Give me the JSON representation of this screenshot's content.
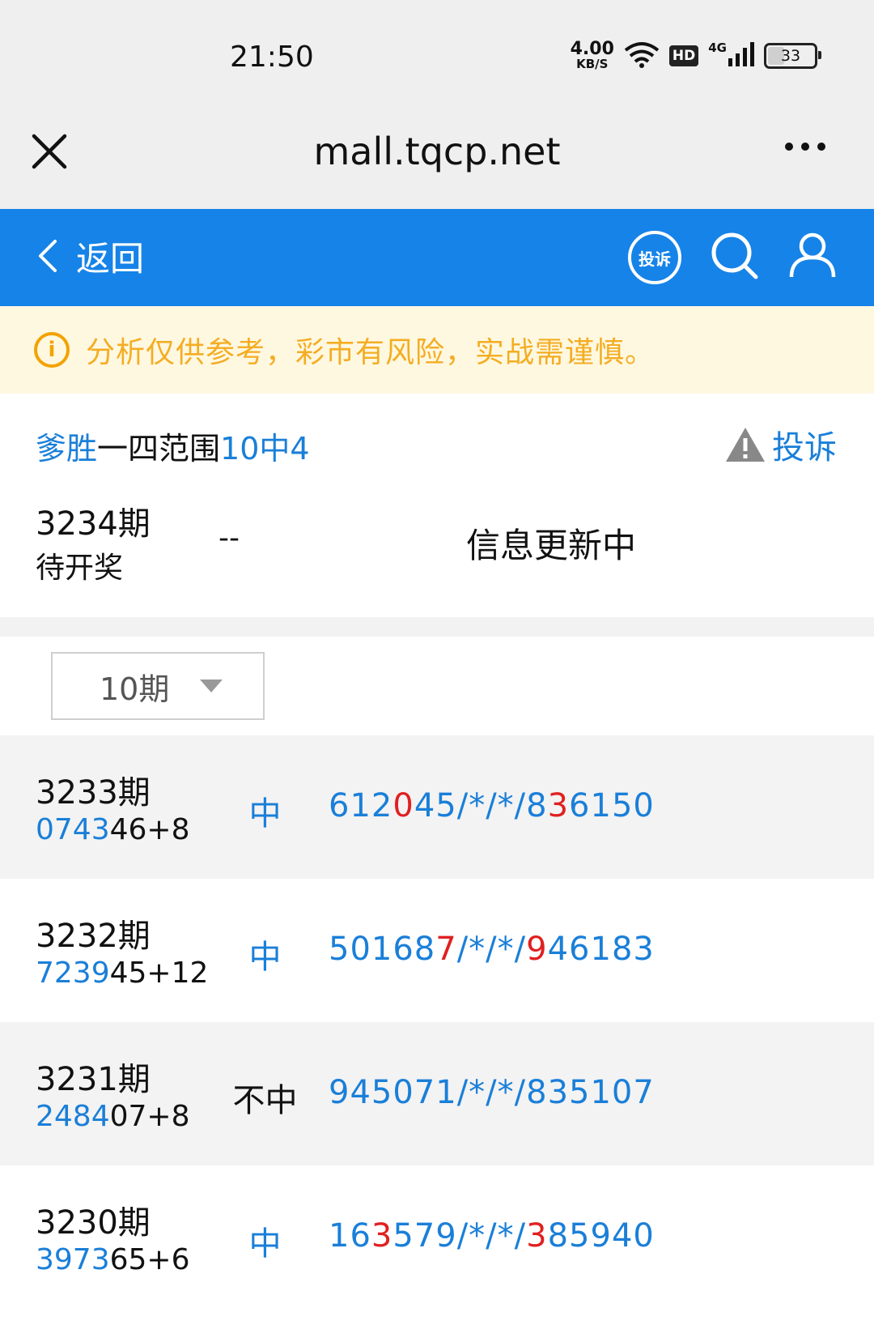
{
  "status_bar": {
    "time": "21:50",
    "net_speed": "4.00",
    "net_speed_unit": "KB/S",
    "hd": "HD",
    "network": "4G",
    "battery": "33"
  },
  "browser": {
    "url": "mall.tqcp.net"
  },
  "header": {
    "back_label": "返回",
    "complain_badge": "投诉"
  },
  "notice": {
    "text": "分析仅供参考，彩市有风险，实战需谨慎。"
  },
  "plan": {
    "title_segments": [
      {
        "text": "爹胜",
        "color": "blue"
      },
      {
        "text": "一四范围",
        "color": "dark"
      },
      {
        "text": "10中4",
        "color": "blue"
      }
    ],
    "complain_label": "投诉"
  },
  "current": {
    "issue": "3234期",
    "status": "待开奖",
    "dash": "--",
    "info": "信息更新中"
  },
  "period_select": {
    "value": "10期"
  },
  "records": [
    {
      "issue": "3233期",
      "draw_hit": "0743",
      "draw_rest": "46+8",
      "result": "中",
      "picks": [
        {
          "t": "612",
          "c": "blue"
        },
        {
          "t": "0",
          "c": "red"
        },
        {
          "t": "45/*/*/8",
          "c": "blue"
        },
        {
          "t": "3",
          "c": "red"
        },
        {
          "t": "6150",
          "c": "blue"
        }
      ]
    },
    {
      "issue": "3232期",
      "draw_hit": "7239",
      "draw_rest": "45+12",
      "result": "中",
      "picks": [
        {
          "t": "50168",
          "c": "blue"
        },
        {
          "t": "7",
          "c": "red"
        },
        {
          "t": "/*/*/",
          "c": "blue"
        },
        {
          "t": "9",
          "c": "red"
        },
        {
          "t": "46183",
          "c": "blue"
        }
      ]
    },
    {
      "issue": "3231期",
      "draw_hit": "2484",
      "draw_rest": "07+8",
      "result": "不中",
      "picks": [
        {
          "t": "945071/*/*/835107",
          "c": "blue"
        }
      ]
    },
    {
      "issue": "3230期",
      "draw_hit": "3973",
      "draw_rest": "65+6",
      "result": "中",
      "picks": [
        {
          "t": "16",
          "c": "blue"
        },
        {
          "t": "3",
          "c": "red"
        },
        {
          "t": "579/*/*/",
          "c": "blue"
        },
        {
          "t": "3",
          "c": "red"
        },
        {
          "t": "85940",
          "c": "blue"
        }
      ]
    }
  ]
}
